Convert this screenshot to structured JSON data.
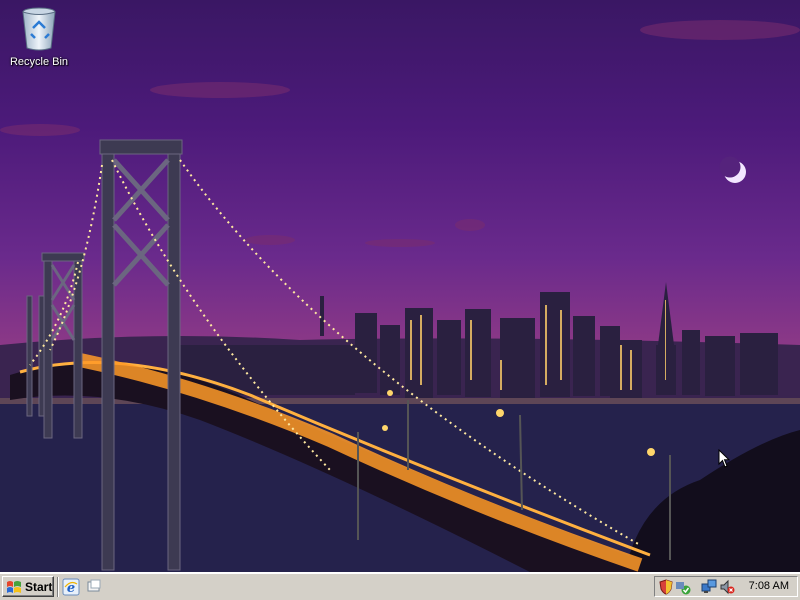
{
  "desktop": {
    "icons": [
      {
        "label": "Recycle Bin",
        "icon": "recycle-bin-icon"
      }
    ],
    "wallpaper": "bay-bridge-night-city-skyline"
  },
  "taskbar": {
    "start_label": "Start",
    "quick_launch": [
      {
        "icon": "internet-explorer-icon"
      },
      {
        "icon": "show-desktop-icon"
      }
    ],
    "tray": {
      "icons": [
        "security-shield-icon",
        "network-icon",
        "volume-muted-icon"
      ],
      "clock": "7:08 AM"
    }
  },
  "colors": {
    "taskbar_bg": "#d4d0c8",
    "sky_top": "#3a1764",
    "sky_horizon": "#b3567e"
  }
}
